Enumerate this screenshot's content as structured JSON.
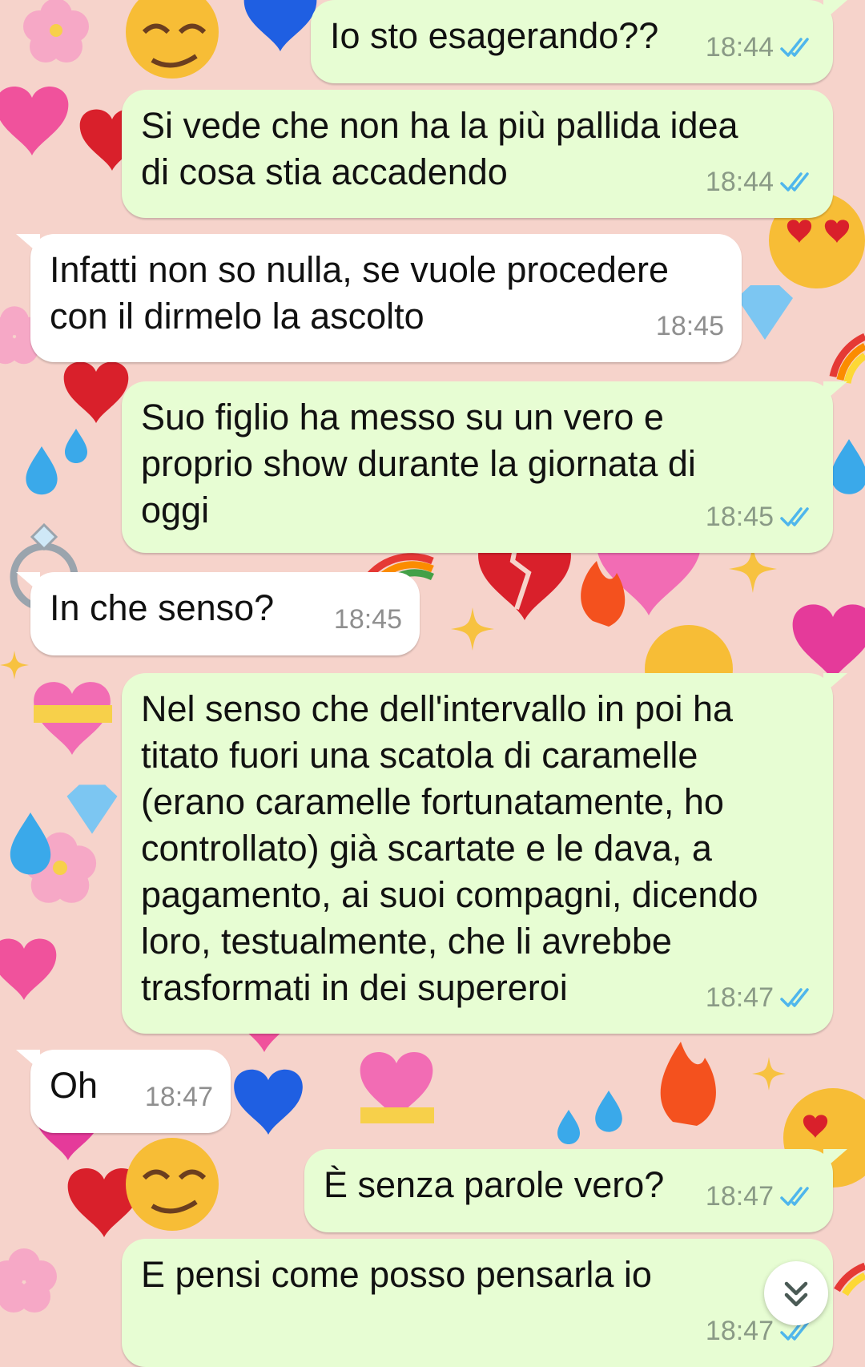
{
  "theme": {
    "outgoing_bubble": "#e7fdd3",
    "incoming_bubble": "#ffffff",
    "read_ticks": "#4fb6ec",
    "wallpaper_bg": "#f6d3cb"
  },
  "messages": [
    {
      "direction": "out",
      "text": "Io sto esagerando??",
      "time": "18:44",
      "status": "read"
    },
    {
      "direction": "out",
      "text": "Si vede che non ha la più pallida idea\ndi cosa stia accadendo",
      "time": "18:44",
      "status": "read"
    },
    {
      "direction": "in",
      "text": "Infatti non so nulla, se vuole procedere\ncon il dirmelo la ascolto",
      "time": "18:45"
    },
    {
      "direction": "out",
      "text": "Suo figlio ha messo su un vero e\nproprio show durante la giornata di\noggi",
      "time": "18:45",
      "status": "read"
    },
    {
      "direction": "in",
      "text": "In che senso?",
      "time": "18:45"
    },
    {
      "direction": "out",
      "text": "Nel senso che dell'intervallo in poi ha\ntitato fuori una scatola di caramelle\n(erano caramelle fortunatamente, ho\ncontrollato) già scartate e le dava, a\npagamento, ai suoi compagni, dicendo\nloro, testualmente, che li avrebbe\ntrasformati in dei supereroi",
      "time": "18:47",
      "status": "read"
    },
    {
      "direction": "in",
      "text": "Oh",
      "time": "18:47"
    },
    {
      "direction": "out",
      "text": "È senza parole vero?",
      "time": "18:47",
      "status": "read"
    },
    {
      "direction": "out",
      "text": "E pensi come posso pensarla io",
      "time": "18:47",
      "status": "read"
    }
  ],
  "icons": {
    "read_receipt": "double-check-icon",
    "scroll_button": "double-chevron-down-icon",
    "wallpaper": [
      "heart-icon",
      "broken-heart-icon",
      "flower-icon",
      "droplet-icon",
      "sparkle-icon",
      "diamond-icon",
      "drooling-face-icon",
      "heart-eyes-face-icon",
      "rainbow-icon",
      "fire-icon",
      "ring-icon"
    ]
  }
}
